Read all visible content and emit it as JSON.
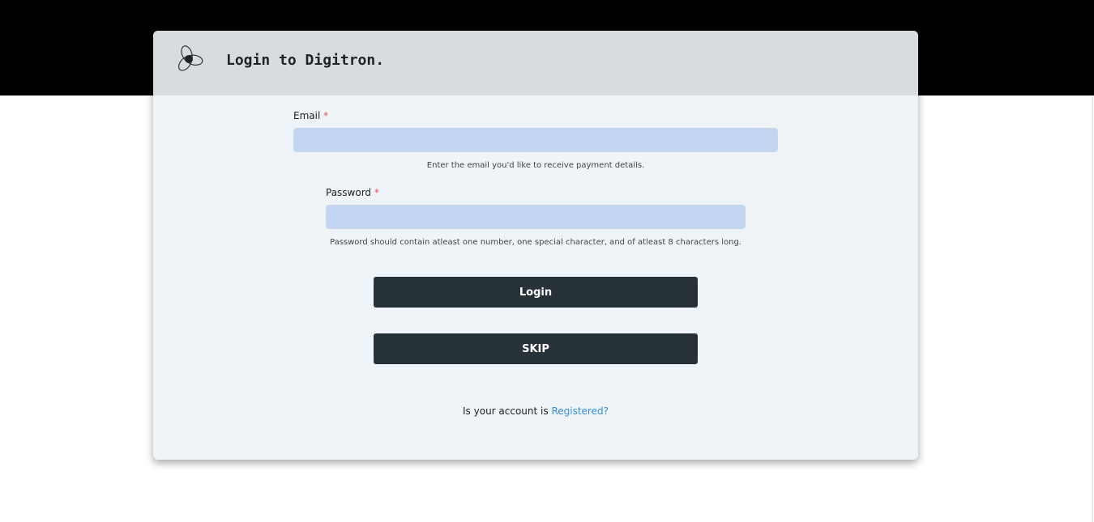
{
  "header": {
    "title": "Login to Digitron.",
    "logo_icon": "digitron-swirl-logo"
  },
  "form": {
    "email": {
      "label": "Email",
      "required_mark": "*",
      "value": "",
      "help": "Enter the email you'd like to receive payment details."
    },
    "password": {
      "label": "Password",
      "required_mark": "*",
      "value": "",
      "help": "Password should contain atleast one number, one special character, and of atleast 8 characters long."
    },
    "login_label": "Login",
    "skip_label": "SKIP"
  },
  "footer": {
    "text": "Is your account is",
    "link": "Registered?"
  },
  "colors": {
    "button": "#263238",
    "input": "#c1d5f1",
    "link": "#3490dc",
    "required": "#e05050"
  }
}
